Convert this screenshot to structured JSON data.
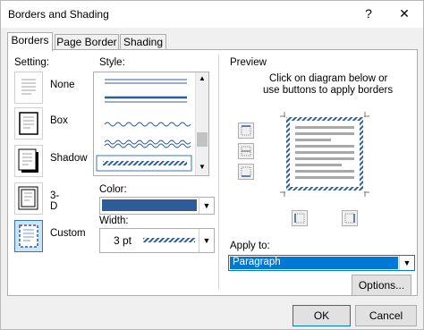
{
  "window": {
    "title": "Borders and Shading",
    "help_label": "?",
    "close_label": "✕"
  },
  "tabs": [
    {
      "label": "Borders",
      "active": true
    },
    {
      "label": "Page Border",
      "active": false
    },
    {
      "label": "Shading",
      "active": false
    }
  ],
  "setting": {
    "heading": "Setting:",
    "options": [
      {
        "label": "None",
        "selected": false
      },
      {
        "label": "Box",
        "selected": false
      },
      {
        "label": "Shadow",
        "selected": false
      },
      {
        "label": "3-D",
        "selected": false
      },
      {
        "label": "Custom",
        "selected": true
      }
    ]
  },
  "style": {
    "heading": "Style:",
    "items": [
      "double-line",
      "thick-thin",
      "wavy",
      "double-wavy",
      "diagonal-striped"
    ],
    "selected_item": "diagonal-striped"
  },
  "color": {
    "heading": "Color:",
    "value_hex": "#2e5c99"
  },
  "width": {
    "heading": "Width:",
    "value": "3 pt"
  },
  "preview": {
    "heading": "Preview",
    "instruction_line1": "Click on diagram below or",
    "instruction_line2": "use buttons to apply borders"
  },
  "apply_to": {
    "heading": "Apply to:",
    "value": "Paragraph"
  },
  "buttons": {
    "options": "Options...",
    "ok": "OK",
    "cancel": "Cancel"
  },
  "colors": {
    "accent": "#3b75b8",
    "border_blue": "#2e5c99",
    "selection_blue": "#cde3f7",
    "combo_highlight": "#0078d7"
  }
}
